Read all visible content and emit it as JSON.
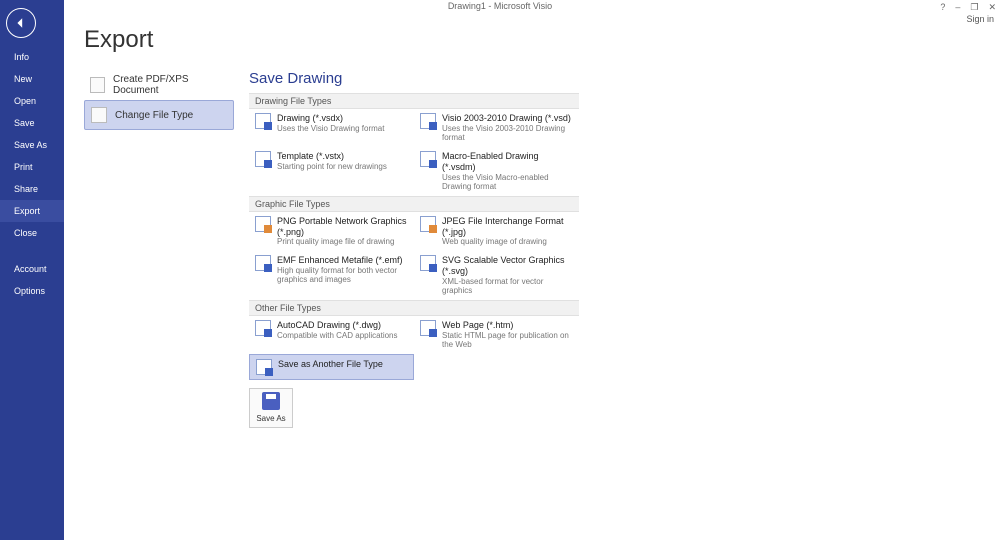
{
  "titlebar": {
    "text": "Drawing1 - Microsoft Visio"
  },
  "window_controls": {
    "help": "?",
    "minimize": "–",
    "restore": "❐",
    "close": "✕"
  },
  "signin": "Sign in",
  "sidebar": {
    "items": [
      {
        "label": "Info"
      },
      {
        "label": "New"
      },
      {
        "label": "Open"
      },
      {
        "label": "Save"
      },
      {
        "label": "Save As"
      },
      {
        "label": "Print"
      },
      {
        "label": "Share"
      },
      {
        "label": "Export",
        "selected": true
      },
      {
        "label": "Close"
      }
    ],
    "bottom": [
      {
        "label": "Account"
      },
      {
        "label": "Options"
      }
    ]
  },
  "page": {
    "title": "Export"
  },
  "export_options": [
    {
      "icon": "pdf",
      "label": "Create PDF/XPS Document"
    },
    {
      "icon": "change",
      "label": "Change File Type",
      "selected": true
    }
  ],
  "save_panel": {
    "title": "Save Drawing",
    "sections": [
      {
        "header": "Drawing File Types",
        "items": [
          {
            "name": "Drawing (*.vsdx)",
            "desc": "Uses the Visio Drawing format"
          },
          {
            "name": "Visio 2003-2010 Drawing (*.vsd)",
            "desc": "Uses the Visio 2003-2010 Drawing format"
          },
          {
            "name": "Template (*.vstx)",
            "desc": "Starting point for new drawings"
          },
          {
            "name": "Macro-Enabled Drawing (*.vsdm)",
            "desc": "Uses the Visio Macro-enabled Drawing format"
          }
        ]
      },
      {
        "header": "Graphic File Types",
        "items": [
          {
            "name": "PNG Portable Network Graphics (*.png)",
            "desc": "Print quality image file of drawing",
            "iconclass": "png"
          },
          {
            "name": "JPEG File Interchange Format (*.jpg)",
            "desc": "Web quality image of drawing",
            "iconclass": "jpg"
          },
          {
            "name": "EMF Enhanced Metafile (*.emf)",
            "desc": "High quality format for both vector graphics and images"
          },
          {
            "name": "SVG Scalable Vector Graphics (*.svg)",
            "desc": "XML-based format for vector graphics"
          }
        ]
      },
      {
        "header": "Other File Types",
        "items": [
          {
            "name": "AutoCAD Drawing (*.dwg)",
            "desc": "Compatible with CAD applications"
          },
          {
            "name": "Web Page (*.htm)",
            "desc": "Static HTML page for publication on the Web"
          },
          {
            "name": "Save as Another File Type",
            "desc": "",
            "selected": true
          }
        ]
      }
    ],
    "saveas_button": "Save As"
  }
}
